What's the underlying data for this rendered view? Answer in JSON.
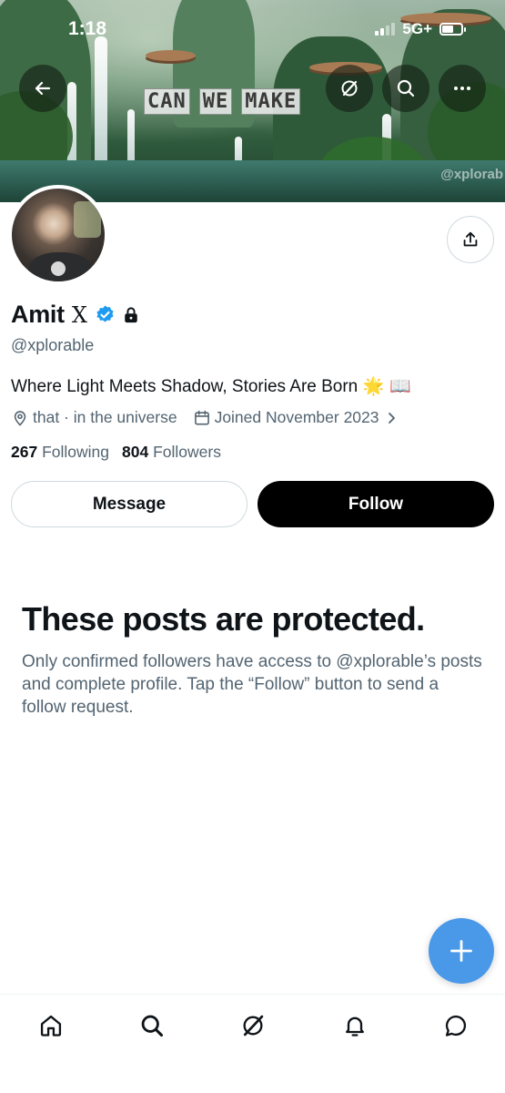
{
  "status_bar": {
    "time": "1:18",
    "network": "5G+"
  },
  "header": {
    "banner_caption": [
      "CAN",
      "WE",
      "MAKE"
    ],
    "banner_watermark": "@xplorab",
    "buttons": [
      "back-arrow-icon",
      "grok-icon",
      "search-icon",
      "more-icon"
    ]
  },
  "profile": {
    "name": "Amit",
    "name_suffix": "X",
    "handle": "@xplorable",
    "bio": "Where Light Meets Shadow, Stories Are Born",
    "bio_emoji": "🌟 📖",
    "location": "that · in the universe",
    "joined": "Joined November 2023",
    "following_count": "267",
    "following_label": "Following",
    "followers_count": "804",
    "followers_label": "Followers",
    "verified_color": "#1d9bf0"
  },
  "actions": {
    "message_label": "Message",
    "follow_label": "Follow"
  },
  "protected": {
    "title": "These posts are protected.",
    "body": "Only confirmed followers have access to @xplorable’s posts and complete profile. Tap the “Follow” button to send a follow request."
  },
  "fab": {
    "icon": "plus-icon",
    "color": "#4a99e9"
  },
  "bottom_nav": [
    "home-icon",
    "search-icon",
    "grok-icon",
    "notifications-icon",
    "messages-icon"
  ]
}
